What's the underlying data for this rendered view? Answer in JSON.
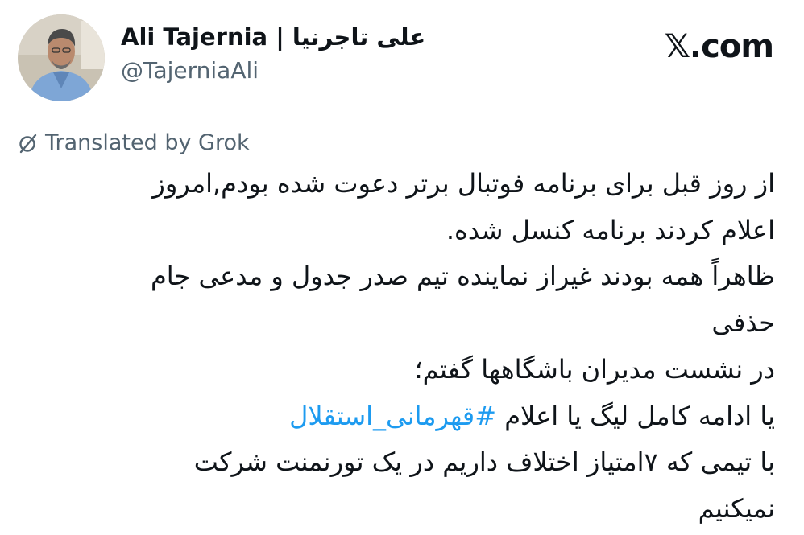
{
  "author": {
    "display_name": "Ali Tajernia | علی تاجرنیا",
    "handle": "@TajerniaAli"
  },
  "site_label": "𝕏.com",
  "translation": {
    "label": "Translated by Grok",
    "icon": "translate-icon"
  },
  "tweet": {
    "lines": [
      "از روز قبل برای برنامه فوتبال برتر دعوت شده بودم,امروز",
      "اعلام کردند برنامه کنسل شده.",
      "ظاهراً همه بودند غیراز نماینده تیم صدر جدول و مدعی جام",
      "حذفی",
      "در نشست مدیران باشگاهها گفتم؛"
    ],
    "hashtag_line_prefix": "یا ادامه کامل لیگ یا اعلام ",
    "hashtag": "#قهرمانی_استقلال",
    "lines_after": [
      "با تیمی که ۷امتیاز اختلاف داریم در یک تورنمنت شرکت",
      "نمیکنیم"
    ]
  },
  "colors": {
    "text": "#0f1419",
    "secondary": "#536471",
    "link": "#1d9bf0"
  }
}
